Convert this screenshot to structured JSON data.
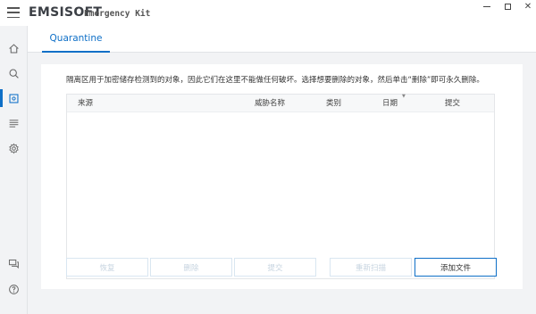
{
  "titlebar": {
    "brand": "EMSISOFT",
    "product": "Emergency Kit",
    "minimize_glyph": "",
    "maximize_glyph": "",
    "close_glyph": "✕"
  },
  "sidebar": {
    "items": [
      {
        "name": "home",
        "icon": "home-icon",
        "active": false
      },
      {
        "name": "scan",
        "icon": "search-icon",
        "active": false
      },
      {
        "name": "quarantine",
        "icon": "quarantine-icon",
        "active": true
      },
      {
        "name": "logs",
        "icon": "list-icon",
        "active": false
      },
      {
        "name": "settings",
        "icon": "gear-icon",
        "active": false
      },
      {
        "name": "feedback",
        "icon": "chat-icon",
        "active": false
      },
      {
        "name": "help",
        "icon": "help-icon",
        "active": false
      }
    ]
  },
  "header": {
    "tab_label": "Quarantine"
  },
  "main": {
    "description": "隔离区用于加密储存检测到的对象，因此它们在这里不能做任何破坏。选择想要删除的对象，然后单击“删除”即可永久删除。",
    "table": {
      "columns": [
        "来源",
        "威胁名称",
        "类别",
        "日期",
        "提交"
      ],
      "rows": []
    },
    "buttons": {
      "restore": "恢复",
      "delete": "删除",
      "submit": "提交",
      "rescan": "重新扫描",
      "add_file": "添加文件"
    }
  },
  "colors": {
    "accent": "#0e6fc7",
    "disabled_text": "#c7d4e0",
    "background": "#f2f3f5"
  }
}
